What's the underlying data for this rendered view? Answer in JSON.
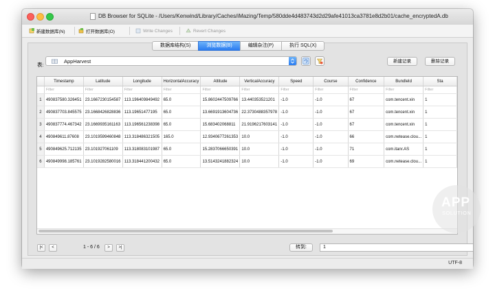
{
  "window": {
    "title": "DB Browser for SQLite - /Users/Kenwind/Library/Caches/iMazing/Temp/580dde4d483743d2d29afe41013ca3781e8d2b01/cache_encryptedA.db"
  },
  "toolbar": {
    "new_db": "新建数据库(N)",
    "open_db": "打开数据库(O)",
    "write_changes": "Write Changes",
    "revert_changes": "Revert Changes"
  },
  "tabs": [
    {
      "label": "数据库结构(S)",
      "active": false
    },
    {
      "label": "浏览数据(B)",
      "active": true
    },
    {
      "label": "编辑杂注(P)",
      "active": false
    },
    {
      "label": "执行 SQL(X)",
      "active": false
    }
  ],
  "browse": {
    "table_label": "表:",
    "table_value": "AppHarvest",
    "new_record": "新建记录",
    "delete_record": "删除记录",
    "filter_placeholder": "Filter",
    "columns": [
      "Timestamp",
      "Latitude",
      "Longitude",
      "HorizontalAccuracy",
      "Altitude",
      "VerticalAccuracy",
      "Speed",
      "Course",
      "Confidence",
      "BundleId",
      "Sta"
    ],
    "rows": [
      [
        "1",
        "490837580.326451",
        "23.1667230154587",
        "113.196409849492",
        "65.0",
        "15.8602447509766",
        "13.440353521201",
        "-1.0",
        "-1.0",
        "67",
        "com.tencent.xin",
        "1"
      ],
      [
        "2",
        "490837703.845575",
        "23.1668426828836",
        "113.19651477195",
        "65.0",
        "13.6691913604736",
        "22.3730488357978",
        "-1.0",
        "-1.0",
        "67",
        "com.tencent.xin",
        "1"
      ],
      [
        "3",
        "490837774.467342",
        "23.1669935161163",
        "113.196561238398",
        "65.0",
        "15.683402068811",
        "21.9196217603141",
        "-1.0",
        "-1.0",
        "67",
        "com.tencent.xin",
        "1"
      ],
      [
        "4",
        "490849611.87608",
        "23.1019599460848",
        "113.318486321505",
        "165.0",
        "12.9340677261353",
        "10.0",
        "-1.0",
        "-1.0",
        "66",
        "com.netease.clou...",
        "1"
      ],
      [
        "5",
        "490849625.712135",
        "23.101927061109",
        "113.318083101987",
        "65.0",
        "15.2837066650391",
        "10.0",
        "-1.0",
        "-1.0",
        "71",
        "com.itanr.AS",
        "1"
      ],
      [
        "6",
        "490849998.185761",
        "23.1019282580016",
        "113.318441200432",
        "65.0",
        "13.5143241882324",
        "10.0",
        "-1.0",
        "-1.0",
        "69",
        "com.netease.clou...",
        "1"
      ]
    ]
  },
  "nav": {
    "first": "|<",
    "prev": "<",
    "range": "1 - 6 / 6",
    "next": ">",
    "last": ">|",
    "goto_label": "转到:",
    "goto_value": "1"
  },
  "status": {
    "encoding": "UTF-8"
  },
  "watermark": {
    "big": "APP",
    "small": "SOLUTION"
  },
  "colors": {
    "accent": "#2b7cf0",
    "close": "#fc605b",
    "minimize": "#fdbc40",
    "maximize": "#34c84a"
  }
}
